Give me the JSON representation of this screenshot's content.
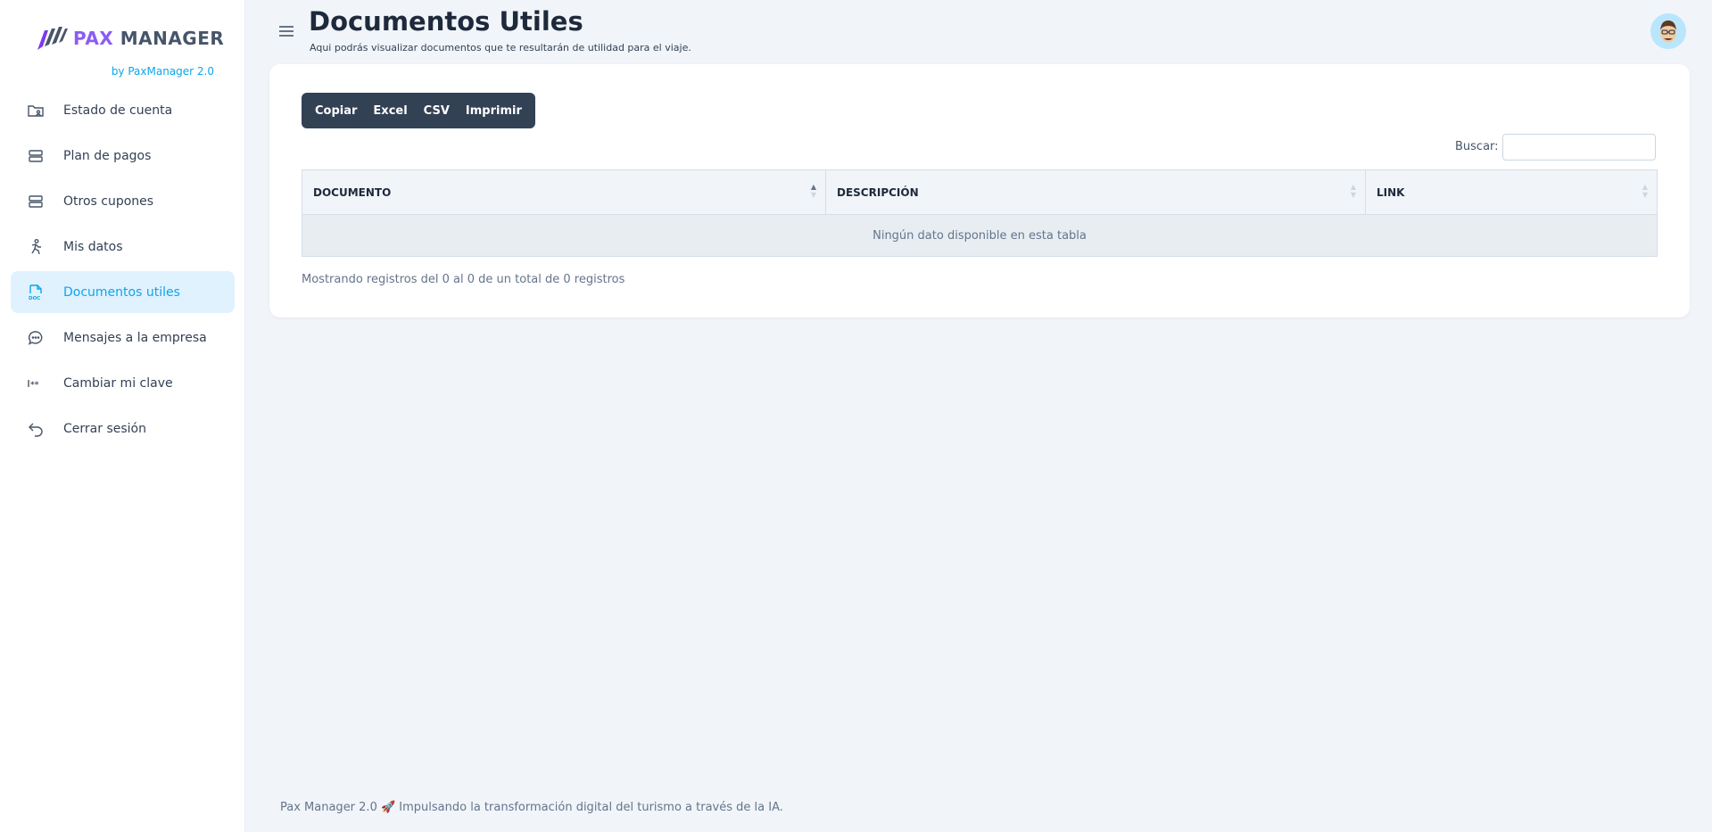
{
  "brand": {
    "name_part1": "PAX",
    "name_part2": "MANAGER",
    "subtitle": "by PaxManager 2.0",
    "accent": "#8b5cf6"
  },
  "sidebar": {
    "items": [
      {
        "label": "Estado de cuenta",
        "icon": "account-folder-icon",
        "active": false
      },
      {
        "label": "Plan de pagos",
        "icon": "stack-icon",
        "active": false
      },
      {
        "label": "Otros cupones",
        "icon": "stack-icon",
        "active": false
      },
      {
        "label": "Mis datos",
        "icon": "person-running-icon",
        "active": false
      },
      {
        "label": "Documentos utiles",
        "icon": "doc-file-icon",
        "active": true
      },
      {
        "label": "Mensajes a la empresa",
        "icon": "chat-bubble-icon",
        "active": false
      },
      {
        "label": "Cambiar mi clave",
        "icon": "password-icon",
        "active": false
      },
      {
        "label": "Cerrar sesión",
        "icon": "logout-arrow-icon",
        "active": false
      }
    ],
    "active_color": "#0ea5e9"
  },
  "header": {
    "title": "Documentos Utiles",
    "subtitle": "Aqui podrás visualizar documentos que te resultarán de utilidad para el viaje."
  },
  "toolbar": {
    "buttons": [
      "Copiar",
      "Excel",
      "CSV",
      "Imprimir"
    ]
  },
  "search": {
    "label": "Buscar:",
    "value": ""
  },
  "table": {
    "columns": [
      "DOCUMENTO",
      "DESCRIPCIÓN",
      "LINK"
    ],
    "empty_message": "Ningún dato disponible en esta tabla",
    "info": "Mostrando registros del 0 al 0 de un total de 0 registros"
  },
  "footer": {
    "text": "Pax Manager 2.0 🚀 Impulsando la transformación digital del turismo a través de la IA."
  }
}
